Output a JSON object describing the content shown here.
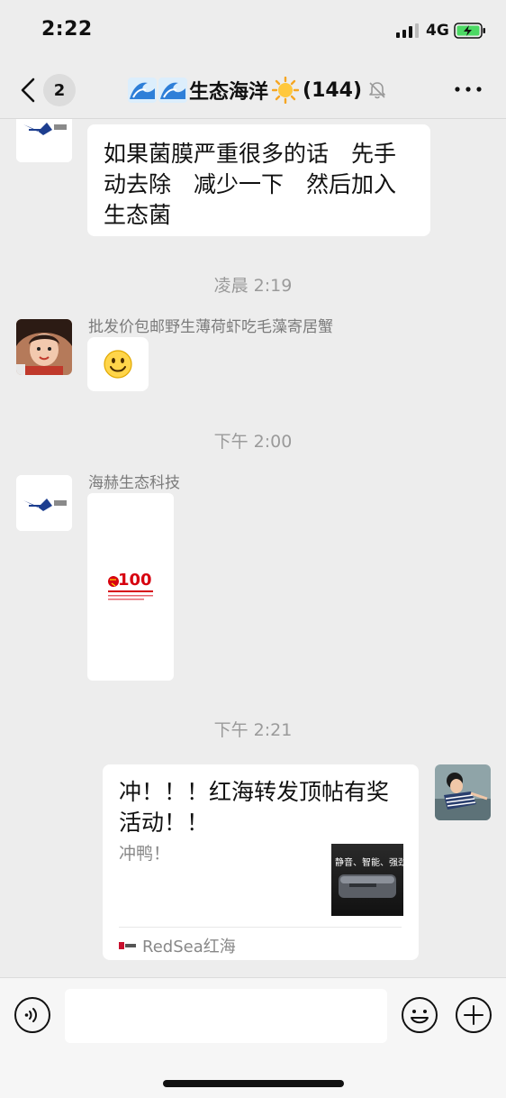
{
  "status_bar": {
    "time": "2:22",
    "network": "4G"
  },
  "nav": {
    "unread_count": "2",
    "title": "生态海洋",
    "member_count": "(144)"
  },
  "messages": [
    {
      "type": "text",
      "side": "left",
      "text": "如果菌膜严重很多的话　先手动去除　减少一下　然后加入生态菌"
    },
    {
      "type": "timestamp",
      "text": "凌晨 2:19"
    },
    {
      "type": "sticker",
      "side": "left",
      "sender": "批发价包邮野生薄荷虾吃毛藻寄居蟹",
      "sticker": "smiley-emoji"
    },
    {
      "type": "timestamp",
      "text": "下午 2:00"
    },
    {
      "type": "image",
      "side": "left",
      "sender": "海赫生态科技",
      "image_text": "100"
    },
    {
      "type": "timestamp",
      "text": "下午 2:21"
    },
    {
      "type": "link-card",
      "side": "right",
      "title": "冲！！！红海转发顶帖有奖活动！！",
      "description": "冲鸭！",
      "thumbnail_text": "静音、智能、强劲",
      "source": "RedSea红海"
    }
  ],
  "colors": {
    "background": "#ededed",
    "bubble": "#ffffff",
    "timestamp": "#9a9a9a",
    "battery": "#4cd964",
    "party_red": "#d7000f"
  }
}
